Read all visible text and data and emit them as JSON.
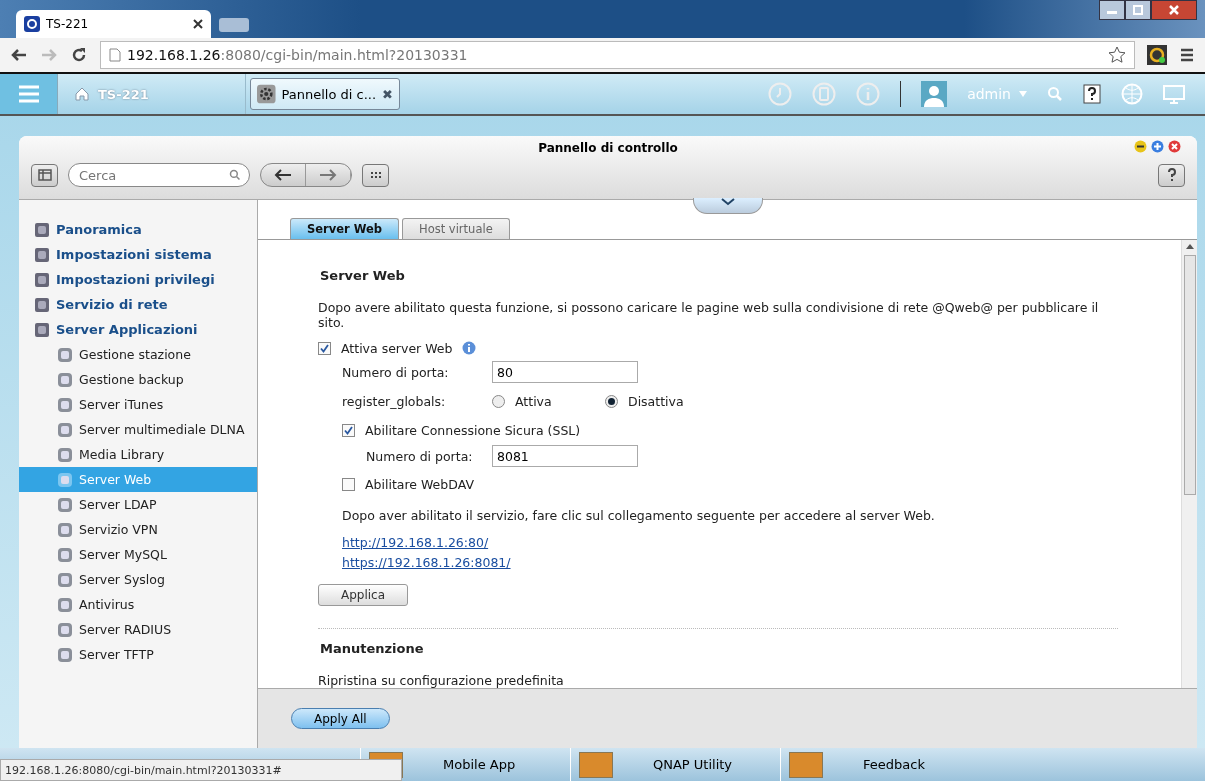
{
  "browser": {
    "tab_title": "TS-221",
    "url_host": "192.168.1.26",
    "url_rest": ":8080/cgi-bin/main.html?20130331",
    "status_url": "192.168.1.26:8080/cgi-bin/main.html?20130331#"
  },
  "topbar": {
    "home": "TS-221",
    "app_tab": "Pannello di c...",
    "close": "✖",
    "user": "admin"
  },
  "window": {
    "title": "Pannello di controllo",
    "search": {
      "placeholder": "Cerca"
    }
  },
  "sidebar": {
    "items": [
      {
        "label": "Panoramica",
        "kind": "group",
        "selected": false
      },
      {
        "label": "Impostazioni sistema",
        "kind": "group",
        "selected": false
      },
      {
        "label": "Impostazioni privilegi",
        "kind": "group",
        "selected": false
      },
      {
        "label": "Servizio di rete",
        "kind": "group",
        "selected": false
      },
      {
        "label": "Server Applicazioni",
        "kind": "group",
        "selected": false
      },
      {
        "label": "Gestione stazione",
        "kind": "item",
        "selected": false
      },
      {
        "label": "Gestione backup",
        "kind": "item",
        "selected": false
      },
      {
        "label": "Server iTunes",
        "kind": "item",
        "selected": false
      },
      {
        "label": "Server multimediale DLNA",
        "kind": "item",
        "selected": false
      },
      {
        "label": "Media Library",
        "kind": "item",
        "selected": false
      },
      {
        "label": "Server Web",
        "kind": "item",
        "selected": true
      },
      {
        "label": "Server LDAP",
        "kind": "item",
        "selected": false
      },
      {
        "label": "Servizio VPN",
        "kind": "item",
        "selected": false
      },
      {
        "label": "Server MySQL",
        "kind": "item",
        "selected": false
      },
      {
        "label": "Server Syslog",
        "kind": "item",
        "selected": false
      },
      {
        "label": "Antivirus",
        "kind": "item",
        "selected": false
      },
      {
        "label": "Server RADIUS",
        "kind": "item",
        "selected": false
      },
      {
        "label": "Server TFTP",
        "kind": "item",
        "selected": false
      }
    ]
  },
  "tabs": [
    {
      "label": "Server Web",
      "selected": true
    },
    {
      "label": "Host virtuale",
      "selected": false
    }
  ],
  "content": {
    "heading": "Server Web",
    "description": "Dopo avere abilitato questa funzione, si possono caricare le pagine web sulla condivisione di rete @Qweb@ per pubblicare il sito.",
    "enable": {
      "label": "Attiva server Web",
      "checked": true
    },
    "port": {
      "label": "Numero di porta:",
      "value": "80"
    },
    "register_globals": {
      "label": "register_globals:",
      "options": [
        {
          "label": "Attiva",
          "selected": false
        },
        {
          "label": "Disattiva",
          "selected": true
        }
      ]
    },
    "ssl": {
      "label": "Abilitare Connessione Sicura (SSL)",
      "checked": true
    },
    "ssl_port": {
      "label": "Numero di porta:",
      "value": "8081"
    },
    "webdav": {
      "label": "Abilitare WebDAV",
      "checked": false
    },
    "hint": "Dopo aver abilitato il servizio, fare clic sul collegamento seguente per accedere al server Web.",
    "links": [
      "http://192.168.1.26:80/",
      "https://192.168.1.26:8081/"
    ],
    "apply": "Applica",
    "maintenance": "Manutenzione",
    "restore": "Ripristina su configurazione predefinita"
  },
  "footer": {
    "apply_all": "Apply All"
  },
  "taskbar": [
    "Mobile App",
    "QNAP Utility",
    "Feedback"
  ]
}
